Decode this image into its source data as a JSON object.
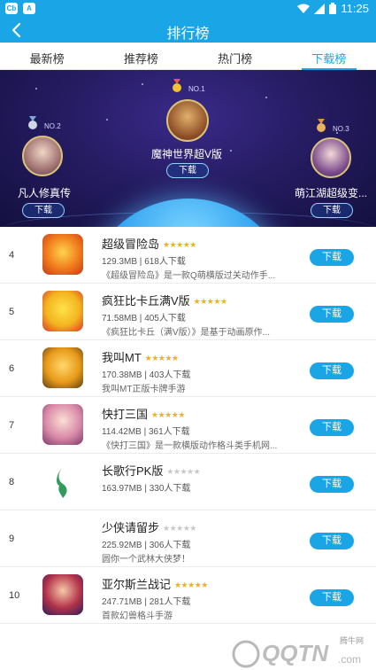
{
  "status_bar": {
    "time": "11:25",
    "badge1": "Cb",
    "badge2": "A"
  },
  "app_bar": {
    "title": "排行榜",
    "back_icon": "back-arrow-icon"
  },
  "tabs": [
    {
      "label": "最新榜",
      "active": false
    },
    {
      "label": "推荐榜",
      "active": false
    },
    {
      "label": "热门榜",
      "active": false
    },
    {
      "label": "下载榜",
      "active": true
    }
  ],
  "podium": {
    "first": {
      "rank": "NO.1",
      "name": "魔神世界超V版",
      "button": "下载"
    },
    "second": {
      "rank": "NO.2",
      "name": "凡人修真传",
      "button": "下载"
    },
    "third": {
      "rank": "NO.3",
      "name": "萌江湖超级变...",
      "button": "下载"
    }
  },
  "list": [
    {
      "rank": "4",
      "name": "超级冒险岛",
      "stars": 5,
      "size": "129.3MB",
      "downloads": "618人下载",
      "desc": "《超级冒险岛》是一款Q萌横版过关动作手...",
      "button": "下载"
    },
    {
      "rank": "5",
      "name": "疯狂比卡丘满V版",
      "stars": 5,
      "size": "71.58MB",
      "downloads": "405人下载",
      "desc": "《疯狂比卡丘（满V版）》是基于动画原作...",
      "button": "下载"
    },
    {
      "rank": "6",
      "name": "我叫MT",
      "stars": 5,
      "size": "170.38MB",
      "downloads": "403人下载",
      "desc": "我叫MT正版卡牌手游",
      "button": "下载"
    },
    {
      "rank": "7",
      "name": "快打三国",
      "stars": 5,
      "size": "114.42MB",
      "downloads": "361人下载",
      "desc": "《快打三国》是一款横版动作格斗类手机网...",
      "button": "下载"
    },
    {
      "rank": "8",
      "name": "长歌行PK版",
      "stars": 0,
      "size": "163.97MB",
      "downloads": "330人下载",
      "desc": "",
      "button": "下载"
    },
    {
      "rank": "9",
      "name": "少侠请留步",
      "stars": 0,
      "size": "225.92MB",
      "downloads": "306人下载",
      "desc": "圆你一个武林大侠梦！",
      "button": "下载"
    },
    {
      "rank": "10",
      "name": "亚尔斯兰战记",
      "stars": 5,
      "size": "247.71MB",
      "downloads": "281人下载",
      "desc": "首款幻兽格斗手游",
      "button": "下载"
    }
  ],
  "colors": {
    "accent": "#1aa6e6",
    "star_on": "#f5b400",
    "star_off": "#c8c8c8"
  },
  "watermark": {
    "text": "QQTN",
    "sub": "腾牛网",
    "domain": ".com"
  }
}
